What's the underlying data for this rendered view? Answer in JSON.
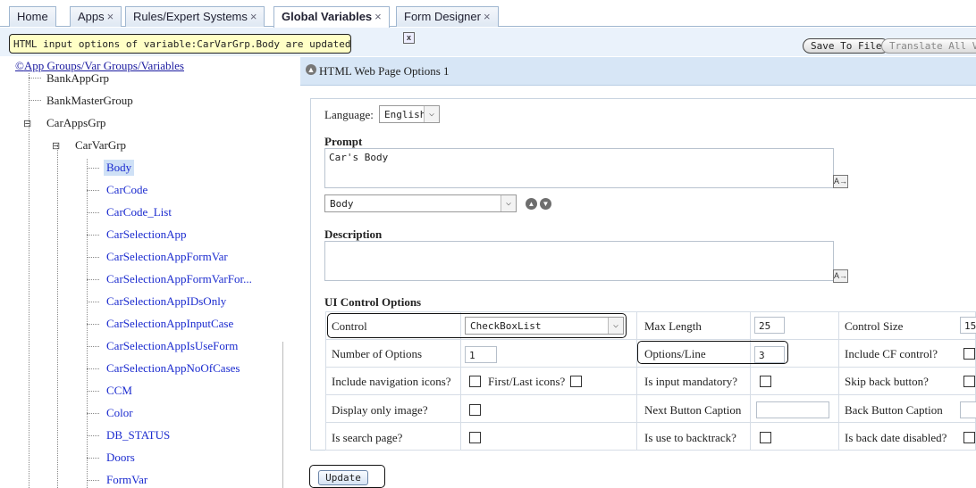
{
  "tabs": [
    {
      "label": "Home",
      "closable": false
    },
    {
      "label": "Apps",
      "closable": true
    },
    {
      "label": "Rules/Expert Systems",
      "closable": true
    },
    {
      "label": "Global Variables",
      "closable": true,
      "active": true
    },
    {
      "label": "Form Designer",
      "closable": true
    }
  ],
  "close_glyph": "×",
  "notice": {
    "message": "HTML input options of variable:CarVarGrp.Body are updated",
    "close_label": "x"
  },
  "toolbar": {
    "save_label": "Save To File",
    "translate_label": "Translate All Vars"
  },
  "tree": {
    "root_symbol": "©",
    "root_label": "App Groups/Var Groups/Variables",
    "groups": [
      "BankAppGrp",
      "BankMasterGroup",
      "CarAppsGrp"
    ],
    "subgroup": "CarVarGrp",
    "variables": [
      "Body",
      "CarCode",
      "CarCode_List",
      "CarSelectionApp",
      "CarSelectionAppFormVar",
      "CarSelectionAppFormVarFor...",
      "CarSelectionAppIDsOnly",
      "CarSelectionAppInputCase",
      "CarSelectionAppIsUseForm",
      "CarSelectionAppNoOfCases",
      "CCM",
      "Color",
      "DB_STATUS",
      "Doors",
      "FormVar"
    ],
    "selected": "Body"
  },
  "panel": {
    "title": "HTML Web Page Options 1"
  },
  "form": {
    "language_label": "Language:",
    "language_value": "English",
    "prompt_label": "Prompt",
    "prompt_value": "Car's Body",
    "prompt_select_value": "Body",
    "description_label": "Description",
    "description_value": "",
    "ui_options_label": "UI Control Options",
    "control_label": "Control",
    "control_value": "CheckBoxList",
    "max_length_label": "Max Length",
    "max_length_value": "25",
    "control_size_label": "Control Size",
    "control_size_value": "15",
    "num_options_label": "Number of Options",
    "num_options_value": "1",
    "options_line_label": "Options/Line",
    "options_line_value": "3",
    "include_cf_label": "Include CF control?",
    "nav_icons_label": "Include navigation icons?",
    "first_last_label": "First/Last icons?",
    "mandatory_label": "Is input mandatory?",
    "skip_back_label": "Skip back button?",
    "display_image_label": "Display only image?",
    "next_caption_label": "Next Button Caption",
    "next_caption_value": "",
    "back_caption_label": "Back Button Caption",
    "search_page_label": "Is search page?",
    "backtrack_label": "Is use to backtrack?",
    "back_date_label": "Is back date disabled?",
    "update_label": "Update"
  },
  "colors": {
    "header_bg": "#d7e6f6",
    "notice_bg": "#ffffc6",
    "link": "#1b2bcf"
  }
}
